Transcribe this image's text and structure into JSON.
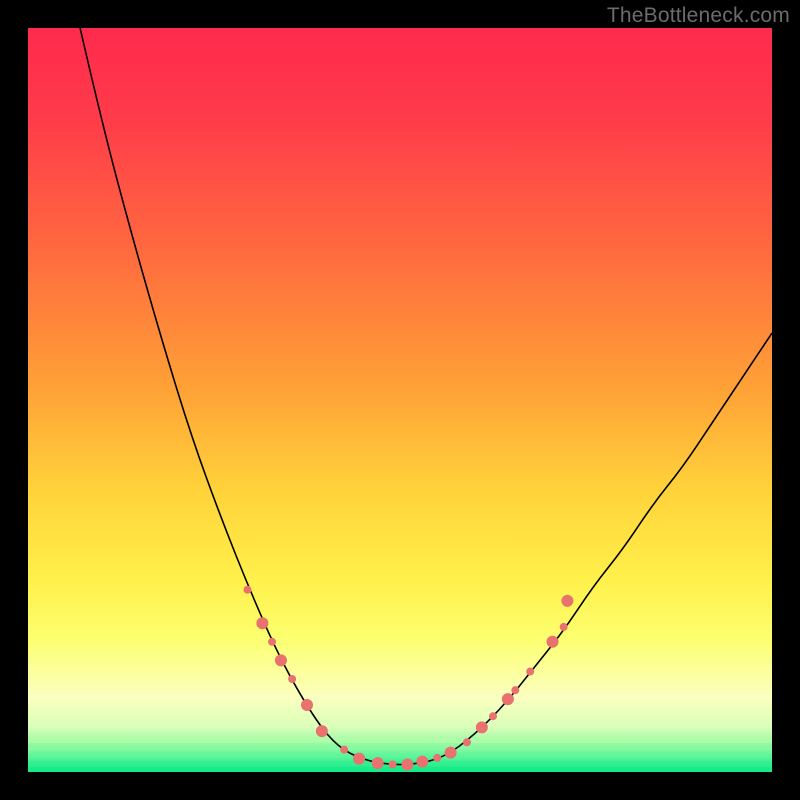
{
  "watermark": "TheBottleneck.com",
  "chart_data": {
    "type": "line",
    "title": "",
    "xlabel": "",
    "ylabel": "",
    "xlim": [
      0,
      100
    ],
    "ylim": [
      0,
      100
    ],
    "grid": false,
    "gradient_stops": [
      {
        "offset": 0.0,
        "color": "#ff2a4d"
      },
      {
        "offset": 0.12,
        "color": "#ff3b4a"
      },
      {
        "offset": 0.3,
        "color": "#ff6a3f"
      },
      {
        "offset": 0.48,
        "color": "#ffa037"
      },
      {
        "offset": 0.62,
        "color": "#ffd23a"
      },
      {
        "offset": 0.74,
        "color": "#fff04a"
      },
      {
        "offset": 0.82,
        "color": "#fcff6e"
      },
      {
        "offset": 0.9,
        "color": "#fbffc0"
      },
      {
        "offset": 0.94,
        "color": "#d9ffb8"
      },
      {
        "offset": 0.97,
        "color": "#7cf7a0"
      },
      {
        "offset": 1.0,
        "color": "#11eb8a"
      }
    ],
    "curve": {
      "color": "#000000",
      "width": 1.6,
      "points": [
        {
          "x": 7,
          "y": 100
        },
        {
          "x": 10,
          "y": 87
        },
        {
          "x": 14,
          "y": 72
        },
        {
          "x": 18,
          "y": 58
        },
        {
          "x": 22,
          "y": 45
        },
        {
          "x": 26,
          "y": 34
        },
        {
          "x": 30,
          "y": 24
        },
        {
          "x": 34,
          "y": 15
        },
        {
          "x": 38,
          "y": 8
        },
        {
          "x": 41,
          "y": 4
        },
        {
          "x": 44,
          "y": 2
        },
        {
          "x": 48,
          "y": 1
        },
        {
          "x": 52,
          "y": 1
        },
        {
          "x": 56,
          "y": 2
        },
        {
          "x": 60,
          "y": 5
        },
        {
          "x": 64,
          "y": 9
        },
        {
          "x": 68,
          "y": 14
        },
        {
          "x": 72,
          "y": 19
        },
        {
          "x": 76,
          "y": 25
        },
        {
          "x": 80,
          "y": 30
        },
        {
          "x": 84,
          "y": 36
        },
        {
          "x": 88,
          "y": 41
        },
        {
          "x": 92,
          "y": 47
        },
        {
          "x": 96,
          "y": 53
        },
        {
          "x": 100,
          "y": 59
        }
      ]
    },
    "markers": {
      "color": "#e9716e",
      "radius_small": 4,
      "radius_large": 6,
      "points": [
        {
          "x": 29.5,
          "y": 24.5,
          "r": "small"
        },
        {
          "x": 31.5,
          "y": 20.0,
          "r": "large"
        },
        {
          "x": 32.8,
          "y": 17.5,
          "r": "small"
        },
        {
          "x": 34.0,
          "y": 15.0,
          "r": "large"
        },
        {
          "x": 35.5,
          "y": 12.5,
          "r": "small"
        },
        {
          "x": 37.5,
          "y": 9.0,
          "r": "large"
        },
        {
          "x": 39.5,
          "y": 5.5,
          "r": "large"
        },
        {
          "x": 42.5,
          "y": 3.0,
          "r": "small"
        },
        {
          "x": 44.5,
          "y": 1.8,
          "r": "large"
        },
        {
          "x": 47.0,
          "y": 1.2,
          "r": "large"
        },
        {
          "x": 49.0,
          "y": 1.0,
          "r": "small"
        },
        {
          "x": 51.0,
          "y": 1.0,
          "r": "large"
        },
        {
          "x": 53.0,
          "y": 1.4,
          "r": "large"
        },
        {
          "x": 55.0,
          "y": 1.9,
          "r": "small"
        },
        {
          "x": 56.8,
          "y": 2.6,
          "r": "large"
        },
        {
          "x": 59.0,
          "y": 4.0,
          "r": "small"
        },
        {
          "x": 61.0,
          "y": 6.0,
          "r": "large"
        },
        {
          "x": 62.5,
          "y": 7.5,
          "r": "small"
        },
        {
          "x": 64.5,
          "y": 9.8,
          "r": "large"
        },
        {
          "x": 65.5,
          "y": 11.0,
          "r": "small"
        },
        {
          "x": 67.5,
          "y": 13.5,
          "r": "small"
        },
        {
          "x": 70.5,
          "y": 17.5,
          "r": "large"
        },
        {
          "x": 72.0,
          "y": 19.5,
          "r": "small"
        },
        {
          "x": 72.5,
          "y": 23.0,
          "r": "large"
        }
      ]
    }
  }
}
